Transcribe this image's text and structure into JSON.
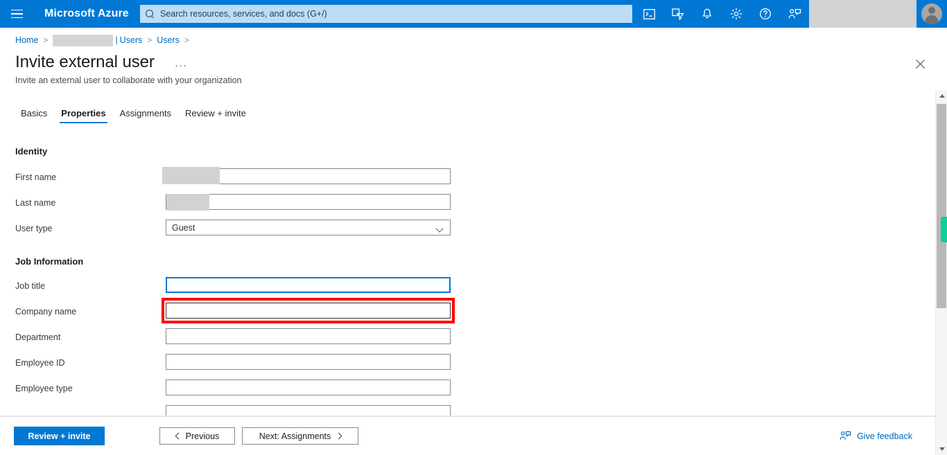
{
  "topbar": {
    "menu_icon": "hamburger-icon",
    "brand": "Microsoft Azure",
    "search_placeholder": "Search resources, services, and docs (G+/)",
    "search_icon": "search-icon",
    "icons": [
      {
        "name": "cloud-shell-icon",
        "label": ">_"
      },
      {
        "name": "directories-subscriptions-filter-icon",
        "label": "filter"
      },
      {
        "name": "notifications-bell-icon",
        "label": "bell"
      },
      {
        "name": "settings-gear-icon",
        "label": "gear"
      },
      {
        "name": "help-question-icon",
        "label": "?"
      },
      {
        "name": "feedback-person-icon",
        "label": "feedback"
      }
    ],
    "redacted_account_label": "",
    "avatar": "user-avatar",
    "brand_color": "#0078d4"
  },
  "breadcrumb": {
    "home": "Home",
    "redacted_tenant": "",
    "pipe": "|",
    "users_1": "Users",
    "users_2": "Users",
    "separator": ">",
    "link_color": "#0067b8"
  },
  "header": {
    "title": "Invite external user",
    "more_label": "···",
    "subtitle": "Invite an external user to collaborate with your organization",
    "close_icon": "close-icon"
  },
  "tabs": [
    {
      "label": "Basics",
      "active": false
    },
    {
      "label": "Properties",
      "active": true
    },
    {
      "label": "Assignments",
      "active": false
    },
    {
      "label": "Review + invite",
      "active": false
    }
  ],
  "sections": {
    "identity": {
      "title": "Identity",
      "fields": [
        {
          "label": "First name",
          "value": "",
          "type": "text",
          "redacted": true,
          "redact_width": 83,
          "state": "normal"
        },
        {
          "label": "Last name",
          "value": "",
          "type": "text",
          "redacted": true,
          "redact_width": 62,
          "state": "normal"
        },
        {
          "label": "User type",
          "value": "Guest",
          "type": "select",
          "redacted": false,
          "state": "normal"
        }
      ]
    },
    "job_information": {
      "title": "Job Information",
      "fields": [
        {
          "label": "Job title",
          "value": "",
          "type": "text",
          "redacted": false,
          "state": "focused"
        },
        {
          "label": "Company name",
          "value": "",
          "type": "text",
          "redacted": false,
          "state": "annotated"
        },
        {
          "label": "Department",
          "value": "",
          "type": "text",
          "redacted": false,
          "state": "normal"
        },
        {
          "label": "Employee ID",
          "value": "",
          "type": "text",
          "redacted": false,
          "state": "normal"
        },
        {
          "label": "Employee type",
          "value": "",
          "type": "text",
          "redacted": false,
          "state": "normal"
        },
        {
          "label": "",
          "value": "",
          "type": "text",
          "redacted": false,
          "state": "clipped"
        }
      ]
    }
  },
  "annotation": {
    "target": "Company name",
    "color": "#ff0000"
  },
  "scrollbar": {
    "up_arrow": "scroll-up-arrow-icon",
    "down_arrow": "scroll-down-arrow-icon",
    "marker_color": "#0ecf9d"
  },
  "footer": {
    "primary": "Review + invite",
    "previous": "Previous",
    "next": "Next: Assignments",
    "feedback": "Give feedback",
    "feedback_icon": "feedback-person-icon",
    "primary_color": "#0078d4"
  }
}
